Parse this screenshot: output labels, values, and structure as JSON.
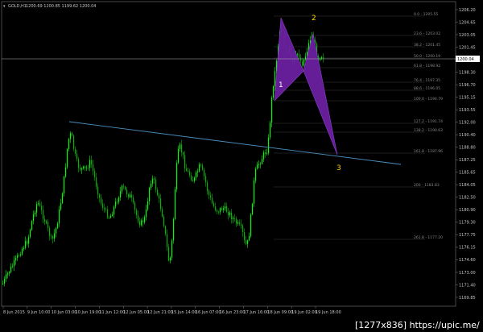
{
  "header": {
    "symbol_tf": "GOLD,H1",
    "ohlc": "1200.69 1200.85 1199.62 1200.04"
  },
  "colors": {
    "background": "#000000",
    "candle_bull": "#00ff00",
    "candle_bear": "#00b400",
    "pattern_fill": "#6a1fa0",
    "pattern_stroke": "#8a3fd0",
    "trendline": "#4a8fbf",
    "fib_lines": "#3a3a3a",
    "point_labels": "#ffd400",
    "axis_text": "#c8c8c8",
    "current_price_bg": "#ffffff",
    "current_price_text": "#000000"
  },
  "price_axis": {
    "ticks": [
      "1206.20",
      "1204.65",
      "1203.05",
      "1201.45",
      "1199.90",
      "1198.30",
      "1196.70",
      "1195.15",
      "1193.55",
      "1192.00",
      "1190.40",
      "1188.80",
      "1187.25",
      "1185.65",
      "1184.05",
      "1182.50",
      "1180.90",
      "1179.30",
      "1177.75",
      "1176.15",
      "1174.60",
      "1173.00",
      "1171.40",
      "1169.85"
    ],
    "current_price": "1200.04"
  },
  "time_axis": {
    "ticks": [
      "8 Jun 2015",
      "9 Jun 10:00",
      "10 Jun 03:00",
      "10 Jun 19:00",
      "11 Jun 12:00",
      "12 Jun 05:00",
      "12 Jun 21:00",
      "15 Jun 14:00",
      "16 Jun 07:00",
      "16 Jun 23:00",
      "17 Jun 16:00",
      "18 Jun 09:00",
      "19 Jun 02:00",
      "19 Jun 18:00"
    ]
  },
  "fib_levels": [
    {
      "label": "0.0 - 1205.55"
    },
    {
      "label": "23.6 - 1203.02"
    },
    {
      "label": "38.2 - 1201.45"
    },
    {
      "label": "50.0 - 1200.19"
    },
    {
      "label": "61.8 - 1198.92"
    },
    {
      "label": "76.4 - 1197.35"
    },
    {
      "label": "88.6 - 1196.05"
    },
    {
      "label": "100.0 - 1194.79"
    },
    {
      "label": "127.2 - 1191.74"
    },
    {
      "label": "138.2 - 1190.63"
    },
    {
      "label": "161.8 - 1187.96"
    },
    {
      "label": "200 - 1183.83"
    },
    {
      "label": "261.8 - 1177.20"
    }
  ],
  "pattern_points": {
    "p1": "1",
    "p2": "2",
    "p3": "3"
  },
  "watermark": "[1277x836] https://upic.me/"
}
